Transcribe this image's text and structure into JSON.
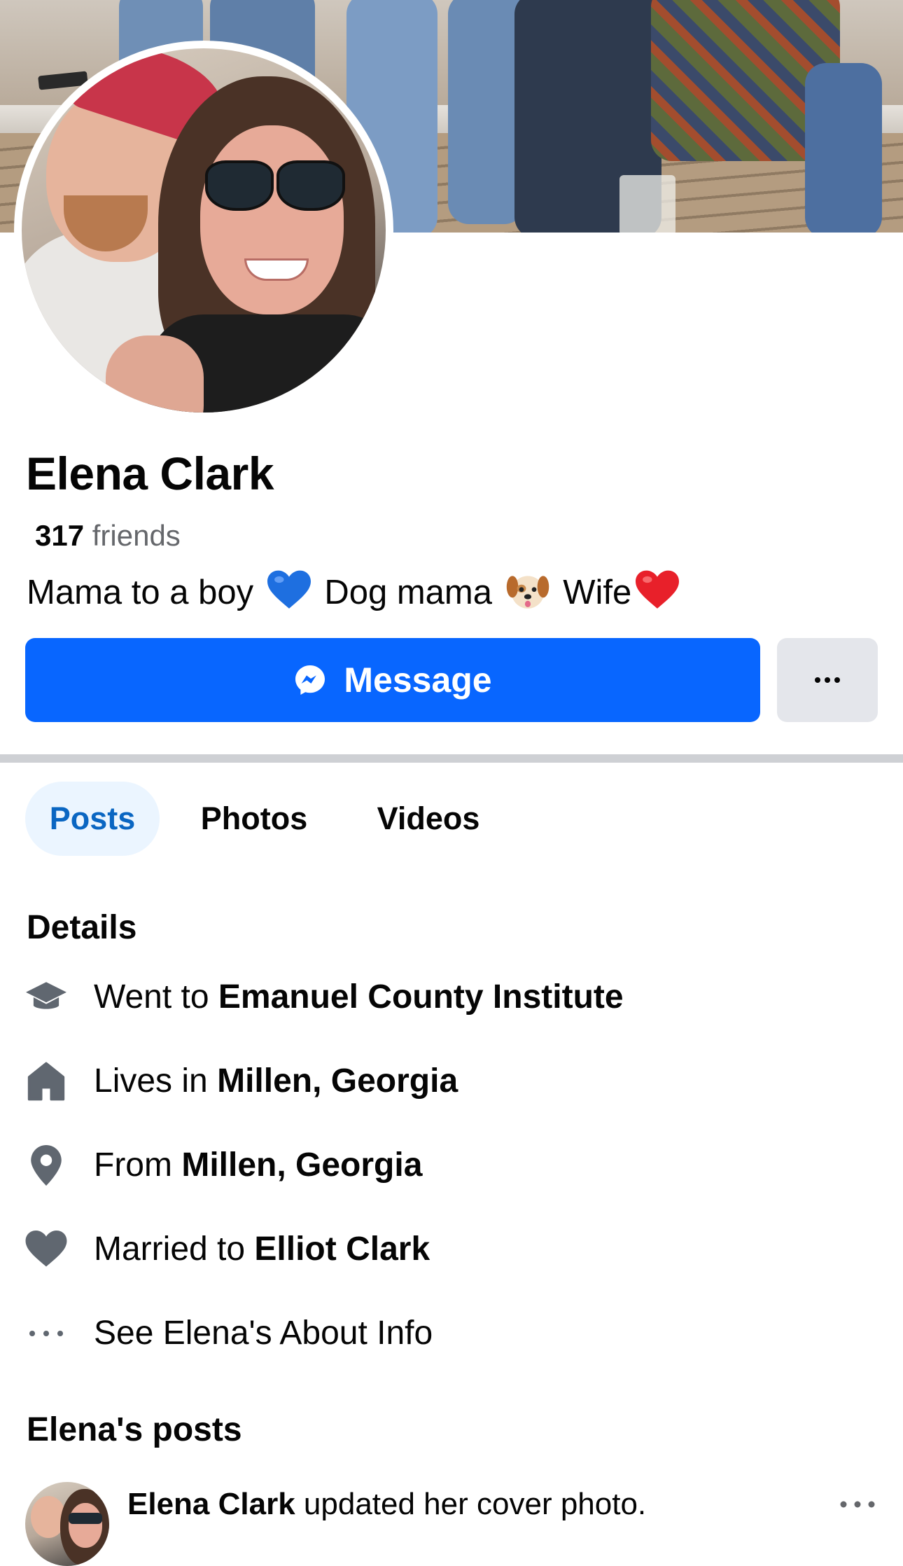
{
  "profile": {
    "name": "Elena Clark",
    "friends_count": "317",
    "friends_label": "friends",
    "bio": {
      "part1": "Mama to a boy",
      "part2": "Dog mama",
      "part3": "Wife"
    }
  },
  "actions": {
    "message_label": "Message",
    "more_label": "More options"
  },
  "tabs": [
    {
      "label": "Posts",
      "active": true
    },
    {
      "label": "Photos",
      "active": false
    },
    {
      "label": "Videos",
      "active": false
    }
  ],
  "details": {
    "title": "Details",
    "items": [
      {
        "prefix": "Went to ",
        "value": "Emanuel County Institute",
        "icon": "graduation-cap-icon"
      },
      {
        "prefix": "Lives in ",
        "value": "Millen, Georgia",
        "icon": "home-icon"
      },
      {
        "prefix": "From ",
        "value": "Millen, Georgia",
        "icon": "location-pin-icon"
      },
      {
        "prefix": "Married to ",
        "value": "Elliot Clark",
        "icon": "heart-icon"
      },
      {
        "prefix": "See Elena's About Info",
        "value": "",
        "icon": "more-dots-icon"
      }
    ]
  },
  "posts": {
    "title": "Elena's posts",
    "first": {
      "author": "Elena Clark",
      "action": " updated her cover photo."
    }
  },
  "colors": {
    "primary": "#0866ff",
    "tab_active_bg": "#ebf5ff",
    "tab_active_text": "#0a66c2",
    "secondary_button": "#e4e6eb",
    "muted_text": "#65676b",
    "icon_gray": "#606770"
  }
}
